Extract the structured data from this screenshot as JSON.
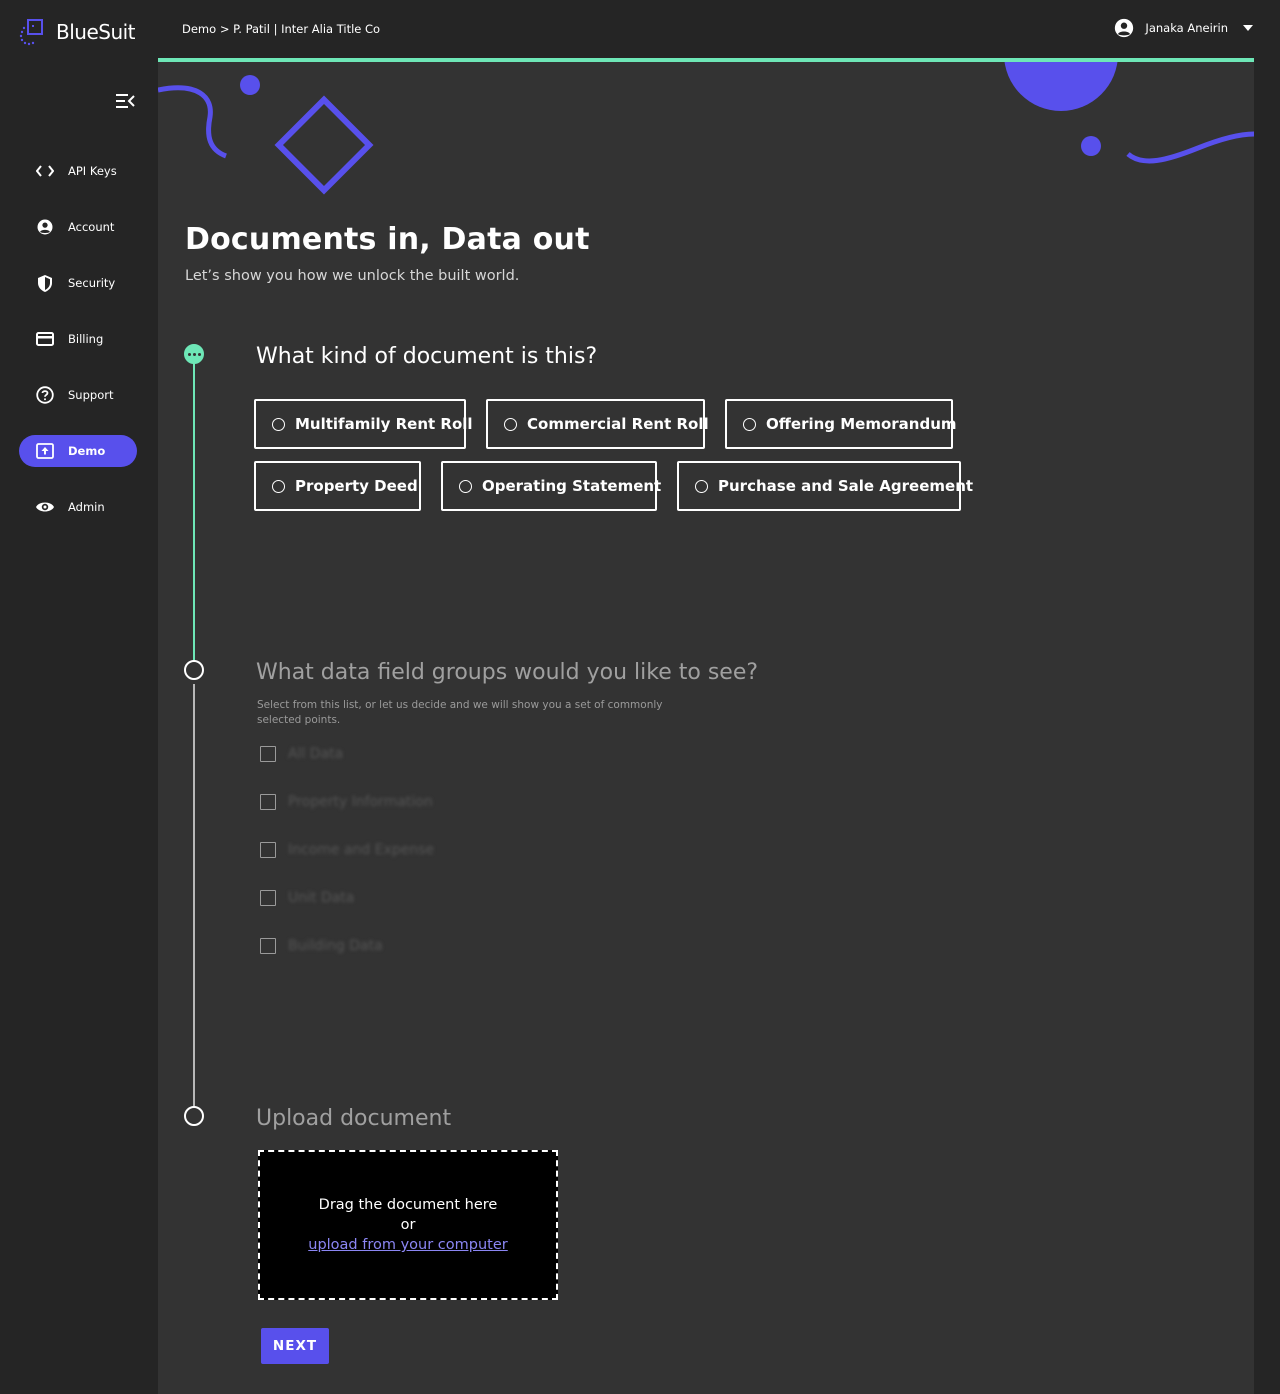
{
  "app": {
    "name": "BlueSuit"
  },
  "header": {
    "breadcrumb": "Demo > P. Patil | Inter Alia Title Co",
    "user_name": "Janaka Aneirin"
  },
  "sidebar": {
    "items": [
      {
        "label": "API Keys",
        "icon": "code-icon"
      },
      {
        "label": "Account",
        "icon": "user-circle-icon"
      },
      {
        "label": "Security",
        "icon": "shield-icon"
      },
      {
        "label": "Billing",
        "icon": "credit-card-icon"
      },
      {
        "label": "Support",
        "icon": "help-circle-icon"
      },
      {
        "label": "Demo",
        "icon": "upload-box-icon",
        "active": true
      },
      {
        "label": "Admin",
        "icon": "eye-icon"
      }
    ]
  },
  "main": {
    "title": "Documents in, Data out",
    "subtitle": "Let’s show you how we unlock the built world.",
    "step1": {
      "title": "What kind of document is this?",
      "options": [
        "Multifamily Rent Roll",
        "Commercial Rent Roll",
        "Offering Memorandum",
        "Property Deed",
        "Operating Statement",
        "Purchase and Sale Agreement"
      ]
    },
    "step2": {
      "title": "What data field groups would you like to see?",
      "hint": "Select from this list, or let us decide and we will show you a set of commonly selected points.",
      "options": [
        "All Data",
        "Property Information",
        "Income and Expense",
        "Unit Data",
        "Building Data"
      ]
    },
    "step3": {
      "title": "Upload document",
      "drag_text": "Drag the document here",
      "or_text": "or",
      "upload_link": "upload from your computer"
    },
    "next_label": "NEXT"
  },
  "colors": {
    "accent": "#5850ec",
    "progress": "#6ee7b7",
    "background": "#252525",
    "card": "#333333"
  }
}
